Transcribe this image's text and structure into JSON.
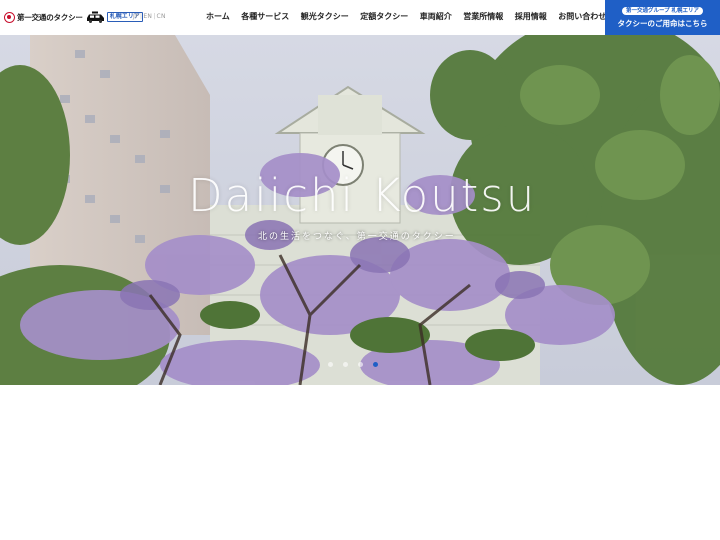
{
  "brand": {
    "name": "第一交通のタクシー",
    "area_badge": "札幌エリア",
    "colors": {
      "accent": "#1f5fc6",
      "logo_red": "#c8102e"
    }
  },
  "languages": {
    "jp": "JP",
    "en": "EN",
    "cn": "CN",
    "separator": "|"
  },
  "nav": {
    "items": [
      "ホーム",
      "各種サービス",
      "観光タクシー",
      "定額タクシー",
      "車両紹介",
      "営業所情報",
      "採用情報",
      "お問い合わせ"
    ]
  },
  "cta": {
    "top": "第一交通グループ 札幌エリア",
    "main": "タクシーのご用命はこちら"
  },
  "hero": {
    "title": "Daiichi Koutsu",
    "subtitle": "北の生活をつなぐ、第一交通のタクシー",
    "slides": 4,
    "active_slide": 4
  }
}
